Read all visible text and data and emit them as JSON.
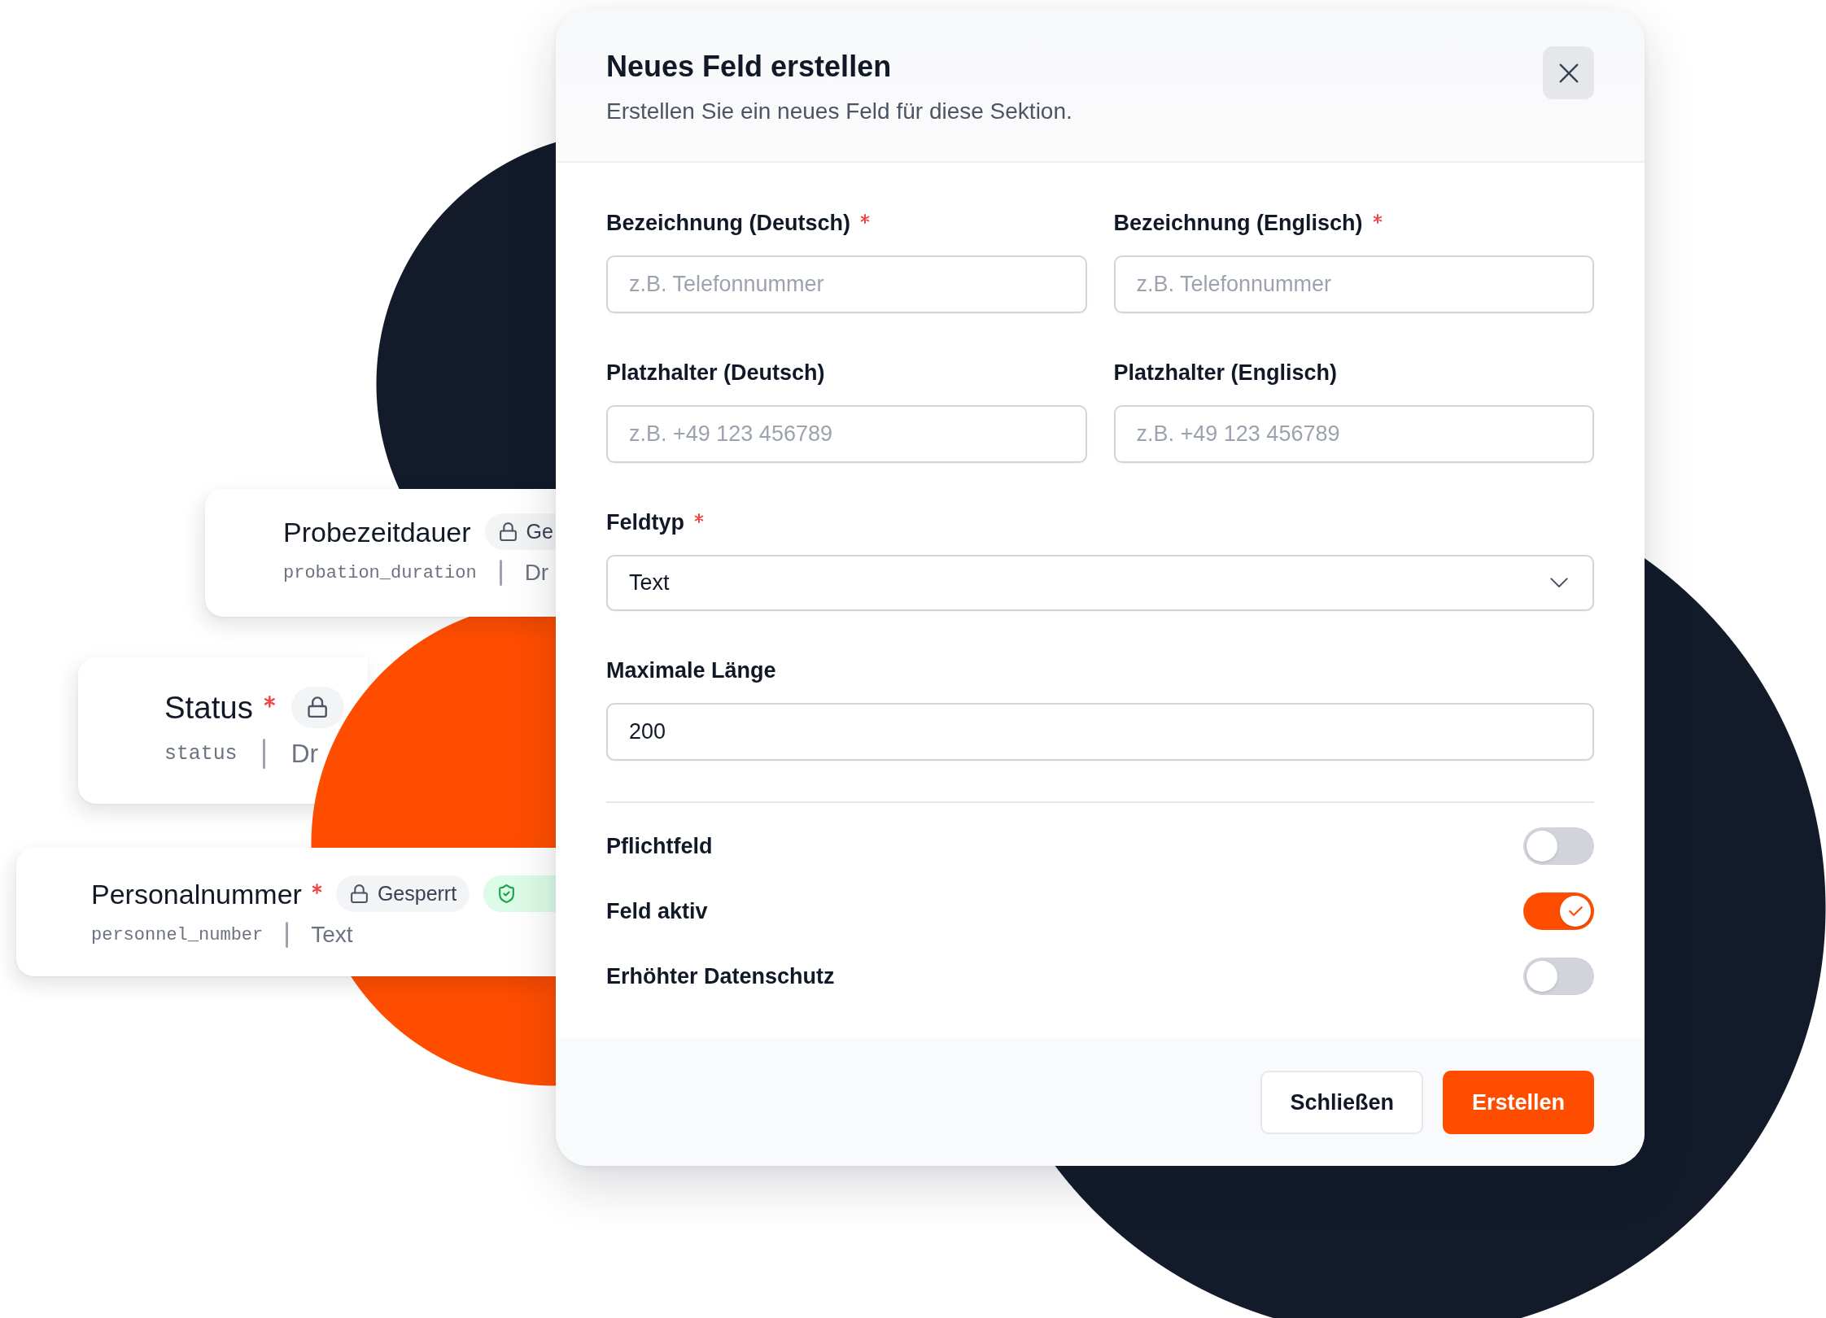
{
  "cards": [
    {
      "title": "Probezeitdauer",
      "required": false,
      "tags": [
        {
          "kind": "locked",
          "label": "Ge"
        }
      ],
      "key": "probation_duration",
      "type": "Dr"
    },
    {
      "title": "Status",
      "required": true,
      "tags": [
        {
          "kind": "locked"
        }
      ],
      "key": "status",
      "type": "Dr"
    },
    {
      "title": "Personalnummer",
      "required": true,
      "tags": [
        {
          "kind": "locked",
          "label": "Gesperrt"
        },
        {
          "kind": "protected"
        }
      ],
      "key": "personnel_number",
      "type": "Text"
    }
  ],
  "dialog": {
    "title": "Neues Feld erstellen",
    "subtitle": "Erstellen Sie ein neues Feld für diese Sektion.",
    "form_rows": [
      [
        {
          "kind": "input",
          "label": "Bezeichnung (Deutsch)",
          "required": true,
          "placeholder": "z.B. Telefonnummer"
        },
        {
          "kind": "input",
          "label": "Bezeichnung (Englisch)",
          "required": true,
          "placeholder": "z.B. Telefonnummer"
        }
      ],
      [
        {
          "kind": "input",
          "label": "Platzhalter (Deutsch)",
          "required": false,
          "placeholder": "z.B. +49 123 456789"
        },
        {
          "kind": "input",
          "label": "Platzhalter (Englisch)",
          "required": false,
          "placeholder": "z.B. +49 123 456789"
        }
      ],
      [
        {
          "kind": "select",
          "label": "Feldtyp",
          "required": true,
          "value": "Text"
        }
      ],
      [
        {
          "kind": "input",
          "label": "Maximale Länge",
          "required": false,
          "value": "200"
        }
      ]
    ],
    "toggles": [
      {
        "label": "Pflichtfeld",
        "on": false
      },
      {
        "label": "Feld aktiv",
        "on": true
      },
      {
        "label": "Erhöhter Datenschutz",
        "on": false
      }
    ],
    "buttons": [
      {
        "kind": "secondary",
        "label": "Schließen"
      },
      {
        "kind": "primary",
        "label": "Erstellen"
      }
    ]
  }
}
